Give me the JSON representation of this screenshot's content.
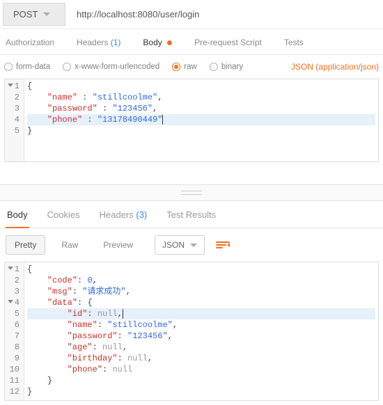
{
  "request": {
    "method": "POST",
    "url": "http://localhost:8080/user/login",
    "tabs": {
      "authorization": "Authorization",
      "headers": "Headers",
      "headers_count": "(1)",
      "body": "Body",
      "prerequest": "Pre-request Script",
      "tests": "Tests"
    },
    "body_types": {
      "formdata": "form-data",
      "urlencoded": "x-www-form-urlencoded",
      "raw": "raw",
      "binary": "binary"
    },
    "content_type_label": "JSON (application/json)",
    "body_json": {
      "name": "stillcoolme",
      "password": "123456",
      "phone": "13178490449"
    },
    "editor_lines": {
      "l1": "{",
      "l2_key": "\"name\"",
      "l2_sep": " : ",
      "l2_val": "\"stillcoolme\"",
      "l2_end": ",",
      "l3_key": "\"password\"",
      "l3_sep": " : ",
      "l3_val": "\"123456\"",
      "l3_end": ",",
      "l4_key": "\"phone\"",
      "l4_sep": " : ",
      "l4_val": "\"13178490449\"",
      "l5": "}"
    }
  },
  "response": {
    "tabs": {
      "body": "Body",
      "cookies": "Cookies",
      "headers": "Headers",
      "headers_count": "(3)",
      "test_results": "Test Results"
    },
    "view_modes": {
      "pretty": "Pretty",
      "raw": "Raw",
      "preview": "Preview"
    },
    "format_label": "JSON",
    "body_json": {
      "code": 0,
      "msg": "请求成功",
      "data": {
        "id": null,
        "name": "stillcoolme",
        "password": "123456",
        "age": null,
        "birthday": null,
        "phone": null
      }
    },
    "editor_lines": {
      "l1": "{",
      "l2_key": "\"code\"",
      "l2_sep": ": ",
      "l2_val": "0",
      "l2_end": ",",
      "l3_key": "\"msg\"",
      "l3_sep": ": ",
      "l3_val": "\"请求成功\"",
      "l3_end": ",",
      "l4_key": "\"data\"",
      "l4_sep": ": ",
      "l4_val": "{",
      "l5_key": "\"id\"",
      "l5_sep": ": ",
      "l5_val": "null",
      "l5_end": ",",
      "l6_key": "\"name\"",
      "l6_sep": ": ",
      "l6_val": "\"stillcoolme\"",
      "l6_end": ",",
      "l7_key": "\"password\"",
      "l7_sep": ": ",
      "l7_val": "\"123456\"",
      "l7_end": ",",
      "l8_key": "\"age\"",
      "l8_sep": ": ",
      "l8_val": "null",
      "l8_end": ",",
      "l9_key": "\"birthday\"",
      "l9_sep": ": ",
      "l9_val": "null",
      "l9_end": ",",
      "l10_key": "\"phone\"",
      "l10_sep": ": ",
      "l10_val": "null",
      "l11": "}",
      "l12": "}"
    }
  },
  "gutter": {
    "n1": "1",
    "n2": "2",
    "n3": "3",
    "n4": "4",
    "n5": "5",
    "n6": "6",
    "n7": "7",
    "n8": "8",
    "n9": "9",
    "n10": "10",
    "n11": "11",
    "n12": "12"
  }
}
